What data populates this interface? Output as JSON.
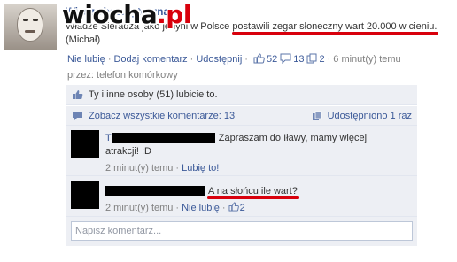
{
  "post": {
    "page_name": "Wiedza bezużyteczna",
    "text_before": "Władze Sieradza jako jedyni w Polsce ",
    "text_highlight": "postawili zegar słoneczny wart 20.000 w cieniu.",
    "text_author": "(Michał)"
  },
  "meta": {
    "unlike": "Nie lubię",
    "add_comment": "Dodaj komentarz",
    "share": "Udostępnij",
    "likes_count": "52",
    "comments_count": "13",
    "shares_count": "2",
    "time": "6 minut(y) temu",
    "via": "przez: telefon komórkowy"
  },
  "ufi": {
    "likes_text": "Ty i inne osoby (51) lubicie to.",
    "see_all": "Zobacz wszystkie komentarze: 13",
    "shared": "Udostępniono 1 raz"
  },
  "comments": [
    {
      "prefix": "T",
      "text": "Zapraszam do Iławy, mamy więcej",
      "text2": "atrakcji! :D",
      "time": "2 minut(y) temu",
      "like": "Lubię to!"
    },
    {
      "text": "A na słońcu ile wart?",
      "time": "2 minut(y) temu",
      "like": "Nie lubię",
      "likes_count": "2"
    }
  ],
  "composer": {
    "placeholder": "Napisz komentarz..."
  },
  "watermark": {
    "black": "wiocha",
    "red": ".pl"
  },
  "colors": {
    "link": "#3b5998",
    "ufi_bg": "#edeff4",
    "highlight": "#d8000c"
  }
}
